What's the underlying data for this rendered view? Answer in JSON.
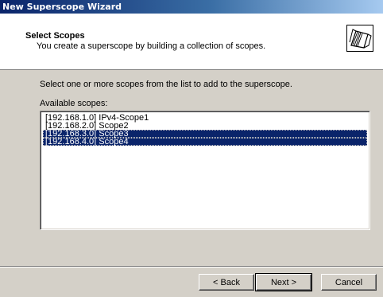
{
  "window": {
    "title": "New Superscope Wizard"
  },
  "header": {
    "title": "Select Scopes",
    "subtitle": "You create a superscope by building a collection of scopes.",
    "icon": "folders-wizard-icon"
  },
  "main": {
    "prompt": "Select one or more scopes from the list to add to the superscope.",
    "list_label": "Available scopes:",
    "scopes": [
      {
        "label": "[192.168.1.0] IPv4-Scope1",
        "selected": false
      },
      {
        "label": "[192.168.2.0] Scope2",
        "selected": false
      },
      {
        "label": "[192.168.3.0] Scope3",
        "selected": true
      },
      {
        "label": "[192.168.4.0] Scope4",
        "selected": true
      }
    ]
  },
  "buttons": {
    "back": "< Back",
    "next": "Next >",
    "cancel": "Cancel"
  },
  "colors": {
    "title_bar": "#0a246a",
    "selection": "#0a246a",
    "dialog_bg": "#d4d0c8"
  }
}
